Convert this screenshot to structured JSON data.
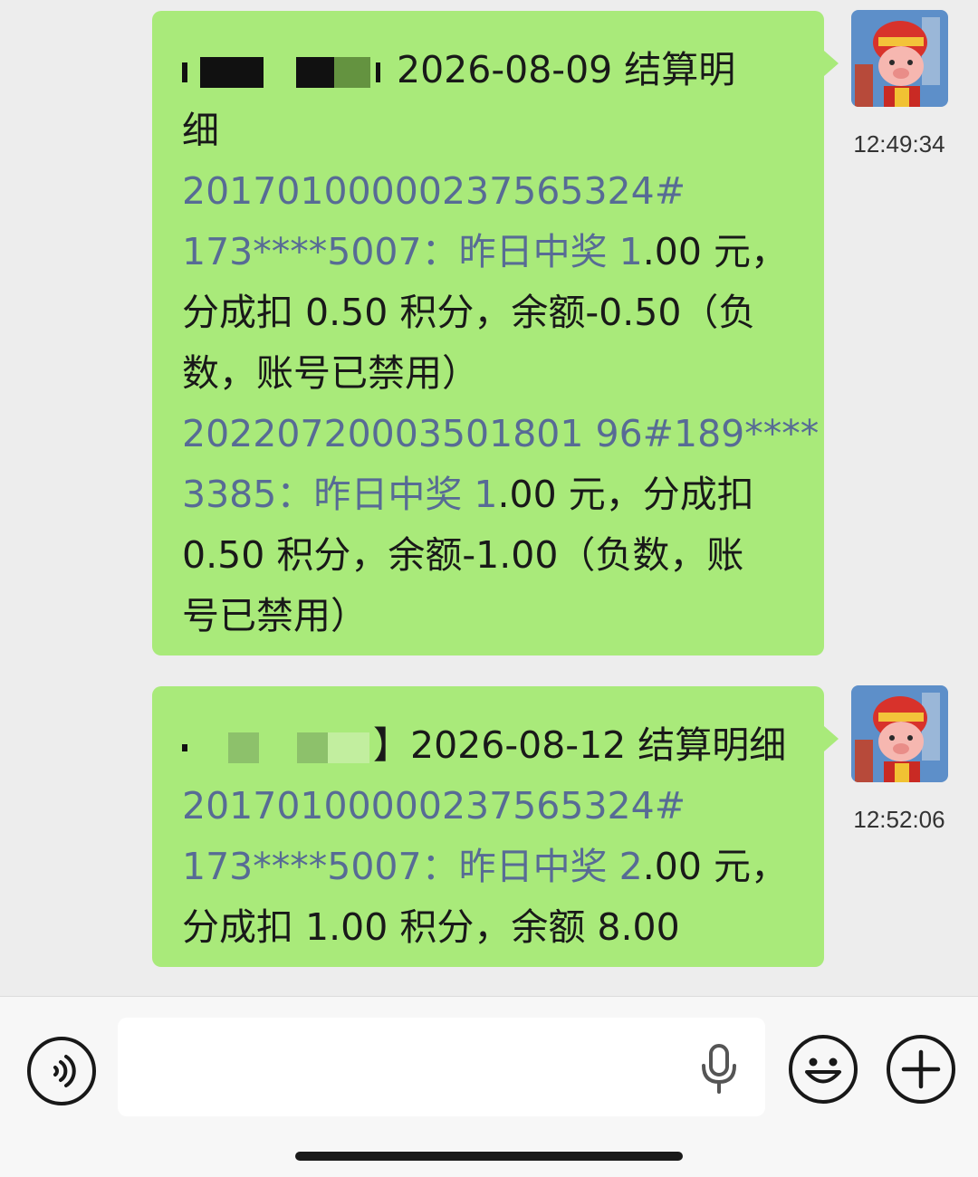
{
  "messages": [
    {
      "time": "12:49:34",
      "lines": [
        {
          "type": "header",
          "suffix": "2026-08-09 结算明"
        },
        {
          "type": "text",
          "parts": [
            {
              "t": "细",
              "link": false
            }
          ]
        },
        {
          "type": "text",
          "parts": [
            {
              "t": "20170100000237565324#",
              "link": true
            }
          ]
        },
        {
          "type": "text",
          "parts": [
            {
              "t": "173****5007：昨日中奖 1",
              "link": true
            },
            {
              "t": ".00 元，",
              "link": false
            }
          ]
        },
        {
          "type": "text",
          "parts": [
            {
              "t": "分成扣 0.50 积分，余额-0.50（负",
              "link": false
            }
          ]
        },
        {
          "type": "text",
          "parts": [
            {
              "t": "数，账号已禁用）",
              "link": false
            }
          ]
        },
        {
          "type": "text",
          "parts": [
            {
              "t": "20220720003501801 96#189****",
              "link": true
            }
          ]
        },
        {
          "type": "text",
          "parts": [
            {
              "t": "3385：昨日中奖 1",
              "link": true
            },
            {
              "t": ".00 元，分成扣",
              "link": false
            }
          ]
        },
        {
          "type": "text",
          "parts": [
            {
              "t": "0.50 积分，余额-1.00（负数，账",
              "link": false
            }
          ]
        },
        {
          "type": "text",
          "parts": [
            {
              "t": "号已禁用）",
              "link": false
            }
          ]
        }
      ]
    },
    {
      "time": "12:52:06",
      "lines": [
        {
          "type": "header",
          "suffix": "】2026-08-12 结算明细"
        },
        {
          "type": "text",
          "parts": [
            {
              "t": "20170100000237565324#",
              "link": true
            }
          ]
        },
        {
          "type": "text",
          "parts": [
            {
              "t": "173****5007：昨日中奖 2",
              "link": true
            },
            {
              "t": ".00 元，",
              "link": false
            }
          ]
        },
        {
          "type": "text",
          "parts": [
            {
              "t": "分成扣 1.00 积分，余额 8.00",
              "link": false
            }
          ]
        }
      ]
    }
  ],
  "input_bar": {
    "text_value": "",
    "voice_icon": "voice-icon",
    "mic_icon": "microphone-icon",
    "emoji_icon": "emoji-icon",
    "plus_icon": "plus-icon"
  },
  "colors": {
    "bubble": "#a9ea7a",
    "link": "#576b95",
    "background": "#ededed"
  }
}
